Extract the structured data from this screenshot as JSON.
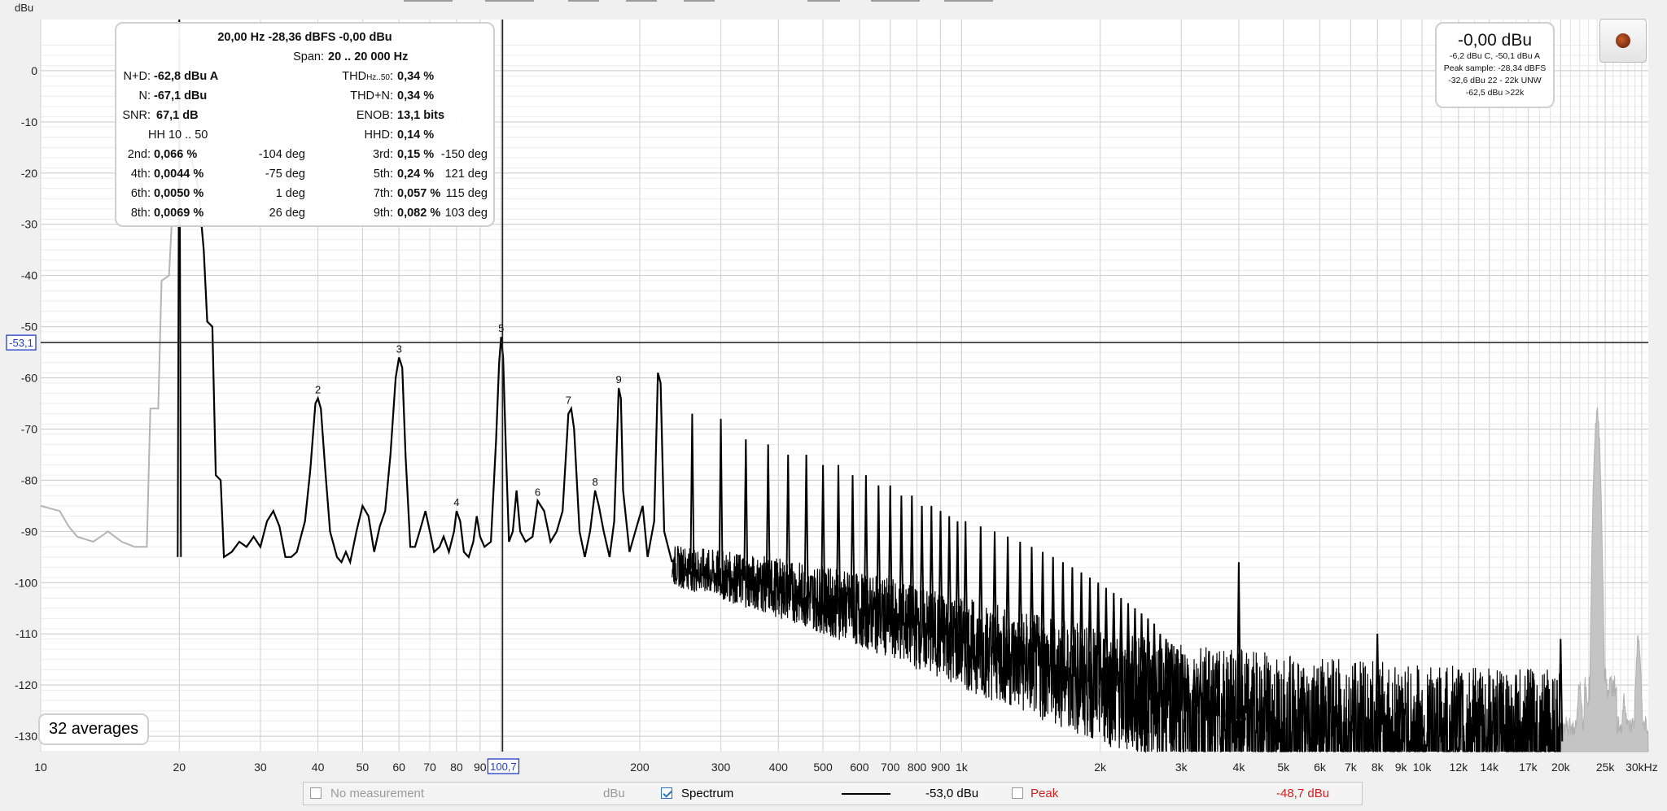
{
  "chart_data": {
    "type": "line",
    "title": "",
    "ylabel": "dBu",
    "xlabel": "",
    "x_scale": "log",
    "xlim": [
      10,
      31000
    ],
    "ylim": [
      -133,
      10
    ],
    "grid": true,
    "y_ticks": [
      "0",
      "-10",
      "-20",
      "-30",
      "-40",
      "-50",
      "-60",
      "-70",
      "-80",
      "-90",
      "-100",
      "-110",
      "-120",
      "-130"
    ],
    "y_tick_values": [
      0,
      -10,
      -20,
      -30,
      -40,
      -50,
      -60,
      -70,
      -80,
      -90,
      -100,
      -110,
      -120,
      -130
    ],
    "x_ticks": [
      {
        "v": 10,
        "t": "10"
      },
      {
        "v": 20,
        "t": "20"
      },
      {
        "v": 30,
        "t": "30"
      },
      {
        "v": 40,
        "t": "40"
      },
      {
        "v": 50,
        "t": "50"
      },
      {
        "v": 60,
        "t": "60"
      },
      {
        "v": 70,
        "t": "70"
      },
      {
        "v": 80,
        "t": "80"
      },
      {
        "v": 90,
        "t": "90"
      },
      {
        "v": 200,
        "t": "200"
      },
      {
        "v": 300,
        "t": "300"
      },
      {
        "v": 400,
        "t": "400"
      },
      {
        "v": 500,
        "t": "500"
      },
      {
        "v": 600,
        "t": "600"
      },
      {
        "v": 700,
        "t": "700"
      },
      {
        "v": 800,
        "t": "800"
      },
      {
        "v": 900,
        "t": "900"
      },
      {
        "v": 1000,
        "t": "1k"
      },
      {
        "v": 2000,
        "t": "2k"
      },
      {
        "v": 3000,
        "t": "3k"
      },
      {
        "v": 4000,
        "t": "4k"
      },
      {
        "v": 5000,
        "t": "5k"
      },
      {
        "v": 6000,
        "t": "6k"
      },
      {
        "v": 7000,
        "t": "7k"
      },
      {
        "v": 8000,
        "t": "8k"
      },
      {
        "v": 9000,
        "t": "9k"
      },
      {
        "v": 10000,
        "t": "10k"
      },
      {
        "v": 12000,
        "t": "12k"
      },
      {
        "v": 14000,
        "t": "14k"
      },
      {
        "v": 17000,
        "t": "17k"
      },
      {
        "v": 20000,
        "t": "20k"
      },
      {
        "v": 25000,
        "t": "25k"
      },
      {
        "v": 30000,
        "t": "30kHz"
      }
    ],
    "cursor": {
      "x": 100.7,
      "y": -53.1,
      "x_label": "100,7",
      "y_label": "-53,1"
    },
    "noise_floor": [
      [
        24,
        -95
      ],
      [
        30,
        -94
      ],
      [
        35,
        -95.5
      ],
      [
        45,
        -95
      ],
      [
        55,
        -93
      ],
      [
        70,
        -92
      ],
      [
        90,
        -92
      ],
      [
        150,
        -94
      ],
      [
        250,
        -97
      ],
      [
        400,
        -101
      ],
      [
        700,
        -107
      ],
      [
        1200,
        -114
      ],
      [
        2000,
        -120
      ],
      [
        3000,
        -125
      ],
      [
        5000,
        -128
      ],
      [
        10000,
        -130
      ],
      [
        20000,
        -131
      ]
    ],
    "series": [
      {
        "name": "Spectrum",
        "points": [
          [
            21,
            -15
          ],
          [
            22,
            -23
          ],
          [
            22.6,
            -35
          ],
          [
            23,
            -49
          ],
          [
            23.6,
            -50
          ],
          [
            24,
            -79
          ],
          [
            24.6,
            -80
          ],
          [
            25,
            -95
          ],
          [
            26,
            -94
          ],
          [
            27,
            -92
          ],
          [
            28,
            -93
          ],
          [
            29,
            -91
          ],
          [
            30,
            -93
          ],
          [
            31,
            -88
          ],
          [
            32,
            -86
          ],
          [
            33,
            -89
          ],
          [
            34,
            -95
          ],
          [
            35,
            -95
          ],
          [
            36,
            -94
          ],
          [
            37.5,
            -88
          ],
          [
            38.5,
            -78
          ],
          [
            39.5,
            -65
          ],
          [
            40,
            -64
          ],
          [
            40.6,
            -66
          ],
          [
            41.5,
            -78
          ],
          [
            42.5,
            -90
          ],
          [
            44,
            -95
          ],
          [
            45,
            -96
          ],
          [
            46,
            -94
          ],
          [
            47,
            -96
          ],
          [
            48.5,
            -90
          ],
          [
            50,
            -85
          ],
          [
            51.5,
            -87
          ],
          [
            53,
            -94
          ],
          [
            54.5,
            -89
          ],
          [
            56,
            -86
          ],
          [
            57.5,
            -75
          ],
          [
            59,
            -60
          ],
          [
            60,
            -56
          ],
          [
            61,
            -58
          ],
          [
            62,
            -75
          ],
          [
            63.5,
            -93
          ],
          [
            65,
            -93
          ],
          [
            66.5,
            -90
          ],
          [
            68.5,
            -86
          ],
          [
            70,
            -90
          ],
          [
            71.5,
            -94
          ],
          [
            73.5,
            -93
          ],
          [
            75,
            -91
          ],
          [
            77,
            -94
          ],
          [
            79,
            -90
          ],
          [
            80,
            -86
          ],
          [
            81.5,
            -88
          ],
          [
            83,
            -94
          ],
          [
            85,
            -95
          ],
          [
            87,
            -92
          ],
          [
            88.5,
            -87
          ],
          [
            90,
            -91
          ],
          [
            92,
            -93
          ],
          [
            95,
            -92
          ],
          [
            97.5,
            -72
          ],
          [
            99,
            -57
          ],
          [
            100,
            -52
          ],
          [
            101,
            -56
          ],
          [
            102.5,
            -75
          ],
          [
            104,
            -92
          ],
          [
            106,
            -90
          ],
          [
            108,
            -82
          ],
          [
            110,
            -90
          ],
          [
            113,
            -92
          ],
          [
            117,
            -91
          ],
          [
            120,
            -84
          ],
          [
            124,
            -86
          ],
          [
            128,
            -92
          ],
          [
            132,
            -90
          ],
          [
            136,
            -86
          ],
          [
            140,
            -67
          ],
          [
            142,
            -66
          ],
          [
            144,
            -70
          ],
          [
            148,
            -90
          ],
          [
            152,
            -95
          ],
          [
            156,
            -90
          ],
          [
            160,
            -82
          ],
          [
            163,
            -85
          ],
          [
            167,
            -90
          ],
          [
            172,
            -95
          ],
          [
            176,
            -88
          ],
          [
            180,
            -62
          ],
          [
            182,
            -64
          ],
          [
            184,
            -82
          ],
          [
            190,
            -94
          ],
          [
            197,
            -89
          ],
          [
            203,
            -85
          ],
          [
            208,
            -95
          ],
          [
            215,
            -88
          ],
          [
            219,
            -59
          ],
          [
            222,
            -61
          ],
          [
            226,
            -90
          ],
          [
            235,
            -96
          ]
        ]
      }
    ],
    "harmonic_peaks": [
      {
        "f": 20,
        "a": 10
      },
      {
        "f": 260,
        "a": -67
      },
      {
        "f": 300,
        "a": -68
      },
      {
        "f": 340,
        "a": -72
      },
      {
        "f": 380,
        "a": -73
      },
      {
        "f": 420,
        "a": -75
      },
      {
        "f": 460,
        "a": -75
      },
      {
        "f": 500,
        "a": -77
      },
      {
        "f": 540,
        "a": -77
      },
      {
        "f": 580,
        "a": -79
      },
      {
        "f": 620,
        "a": -79
      },
      {
        "f": 660,
        "a": -81
      },
      {
        "f": 700,
        "a": -81
      },
      {
        "f": 740,
        "a": -83
      },
      {
        "f": 780,
        "a": -83
      },
      {
        "f": 820,
        "a": -85
      },
      {
        "f": 860,
        "a": -85
      },
      {
        "f": 900,
        "a": -86
      },
      {
        "f": 940,
        "a": -87
      },
      {
        "f": 980,
        "a": -88
      },
      {
        "f": 1020,
        "a": -88
      },
      {
        "f": 1100,
        "a": -89
      },
      {
        "f": 1180,
        "a": -90
      },
      {
        "f": 1260,
        "a": -91
      },
      {
        "f": 1340,
        "a": -92
      },
      {
        "f": 1420,
        "a": -93
      },
      {
        "f": 1500,
        "a": -94
      },
      {
        "f": 1580,
        "a": -95
      },
      {
        "f": 1660,
        "a": -96
      },
      {
        "f": 1740,
        "a": -97
      },
      {
        "f": 1820,
        "a": -98
      },
      {
        "f": 1900,
        "a": -99
      },
      {
        "f": 1980,
        "a": -100
      },
      {
        "f": 2060,
        "a": -101
      },
      {
        "f": 2140,
        "a": -102
      },
      {
        "f": 2220,
        "a": -103
      },
      {
        "f": 2300,
        "a": -104
      },
      {
        "f": 2380,
        "a": -105
      },
      {
        "f": 2460,
        "a": -106
      },
      {
        "f": 2540,
        "a": -107
      },
      {
        "f": 2620,
        "a": -108
      },
      {
        "f": 2700,
        "a": -110
      },
      {
        "f": 2780,
        "a": -111
      },
      {
        "f": 2860,
        "a": -112
      },
      {
        "f": 2940,
        "a": -113
      },
      {
        "f": 3020,
        "a": -114
      },
      {
        "f": 3100,
        "a": -116
      },
      {
        "f": 3200,
        "a": -117
      },
      {
        "f": 3300,
        "a": -118
      },
      {
        "f": 3400,
        "a": -119
      },
      {
        "f": 3500,
        "a": -120
      },
      {
        "f": 3600,
        "a": -121
      },
      {
        "f": 3700,
        "a": -122
      },
      {
        "f": 3800,
        "a": -123
      },
      {
        "f": 4000,
        "a": -96
      },
      {
        "f": 4100,
        "a": -124
      },
      {
        "f": 4400,
        "a": -125
      },
      {
        "f": 4700,
        "a": -126
      },
      {
        "f": 5000,
        "a": -127
      },
      {
        "f": 6000,
        "a": -127
      },
      {
        "f": 7000,
        "a": -128
      },
      {
        "f": 8000,
        "a": -110
      },
      {
        "f": 9000,
        "a": -121
      },
      {
        "f": 10000,
        "a": -128
      },
      {
        "f": 12000,
        "a": -117
      },
      {
        "f": 16000,
        "a": -118
      },
      {
        "f": 20000,
        "a": -111
      }
    ],
    "reference_trace": {
      "name": "No measurement",
      "low_end": [
        [
          10,
          -85
        ],
        [
          11,
          -86
        ],
        [
          11.5,
          -89
        ],
        [
          12,
          -91
        ],
        [
          13,
          -92
        ],
        [
          14,
          -90
        ],
        [
          15,
          -92
        ],
        [
          16,
          -93
        ],
        [
          17,
          -93
        ],
        [
          17.3,
          -66
        ],
        [
          18,
          -66
        ],
        [
          18.3,
          -41
        ],
        [
          19,
          -40
        ],
        [
          19.3,
          -28
        ],
        [
          20,
          -26
        ],
        [
          21,
          -18
        ]
      ],
      "spikes": [
        {
          "f": 24000,
          "a": -67
        },
        {
          "f": 29500,
          "a": -111
        },
        {
          "f": 22000,
          "a": -120
        },
        {
          "f": 25000,
          "a": -118
        },
        {
          "f": 27500,
          "a": -123
        }
      ]
    },
    "harmonic_labels": [
      {
        "n": "2",
        "f": 40,
        "a": -64
      },
      {
        "n": "3",
        "f": 60,
        "a": -56
      },
      {
        "n": "4",
        "f": 80,
        "a": -86
      },
      {
        "n": "5",
        "f": 100,
        "a": -52
      },
      {
        "n": "6",
        "f": 120,
        "a": -84
      },
      {
        "n": "7",
        "f": 140,
        "a": -66
      },
      {
        "n": "8",
        "f": 160,
        "a": -82
      },
      {
        "n": "9",
        "f": 180,
        "a": -62
      }
    ]
  },
  "info_panel": {
    "header": "20,00 Hz  -28,36 dBFS  -0,00 dBu",
    "span_label": "Span:",
    "span_value": "20 .. 20 000 Hz",
    "nd_label": "N+D:",
    "nd_value": "-62,8 dBu A",
    "thd_hz_label": "THD",
    "thd_hz_sub": "Hz..50",
    "thd_hz_colon": ":",
    "thd_hz_value": "0,34 %",
    "n_label": "N:",
    "n_value": "-67,1 dBu",
    "thdn_label": "THD+N:",
    "thdn_value": "0,34 %",
    "snr_label": "SNR:",
    "snr_value": "67,1 dB",
    "enob_label": "ENOB:",
    "enob_value": "13,1 bits",
    "hh_label": "HH 10 .. 50",
    "hhd_label": "HHD:",
    "hhd_value": "0,14 %",
    "harmonics": [
      {
        "l": "2nd:",
        "v": "0,066 %",
        "p": "-104 deg"
      },
      {
        "l": "3rd:",
        "v": "0,15 %",
        "p": "-150 deg"
      },
      {
        "l": "4th:",
        "v": "0,0044 %",
        "p": "-75 deg"
      },
      {
        "l": "5th:",
        "v": "0,24 %",
        "p": "121 deg"
      },
      {
        "l": "6th:",
        "v": "0,0050 %",
        "p": "1 deg"
      },
      {
        "l": "7th:",
        "v": "0,057 %",
        "p": "115 deg"
      },
      {
        "l": "8th:",
        "v": "0,0069 %",
        "p": "26 deg"
      },
      {
        "l": "9th:",
        "v": "0,082 %",
        "p": "103 deg"
      }
    ]
  },
  "level_panel": {
    "main": "-0,00 dBu",
    "lines": [
      "-6,2 dBu C, -50,1 dBu A",
      "Peak sample: -28,34 dBFS",
      "-32,6 dBu 22 - 22k UNW",
      "-62,5 dBu >22k"
    ]
  },
  "averages_label": "32 averages",
  "record_icon": "record-icon",
  "legend": {
    "no_measurement": "No measurement",
    "unit": "dBu",
    "spectrum": "Spectrum",
    "spectrum_value": "-53,0 dBu",
    "peak": "Peak",
    "peak_value": "-48,7 dBu",
    "peak_color": "#d02020"
  }
}
